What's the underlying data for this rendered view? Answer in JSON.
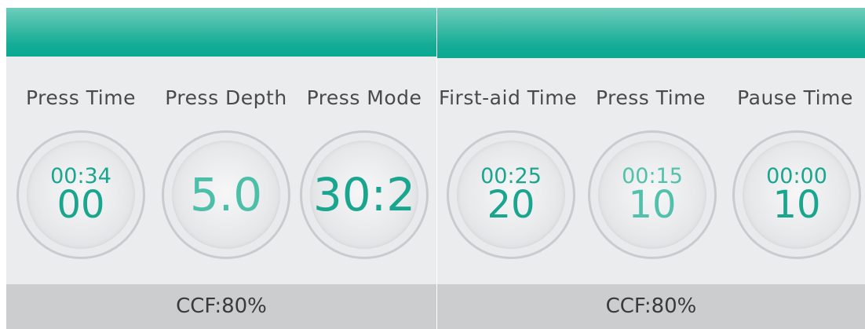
{
  "left_panel": {
    "metrics": [
      {
        "label": "Press Time",
        "top_value": "00:34",
        "main_value": "00"
      },
      {
        "label": "Press Depth",
        "main_value": "5.0"
      },
      {
        "label": "Press Mode",
        "main_value": "30:2"
      }
    ],
    "footer": "CCF:80%"
  },
  "right_panel": {
    "metrics": [
      {
        "label": "First-aid Time",
        "top_value": "00:25",
        "main_value": "20"
      },
      {
        "label": "Press Time",
        "top_value": "00:15",
        "main_value": "10"
      },
      {
        "label": "Pause Time",
        "top_value": "00:00",
        "main_value": "10"
      }
    ],
    "footer": "CCF:80%"
  },
  "colors": {
    "header_teal": "#14ac96",
    "value_teal": "#1aa58f",
    "value_teal_light": "#52c1ac",
    "panel_bg": "#ebecee",
    "footer_bg": "#cbcdcf"
  }
}
